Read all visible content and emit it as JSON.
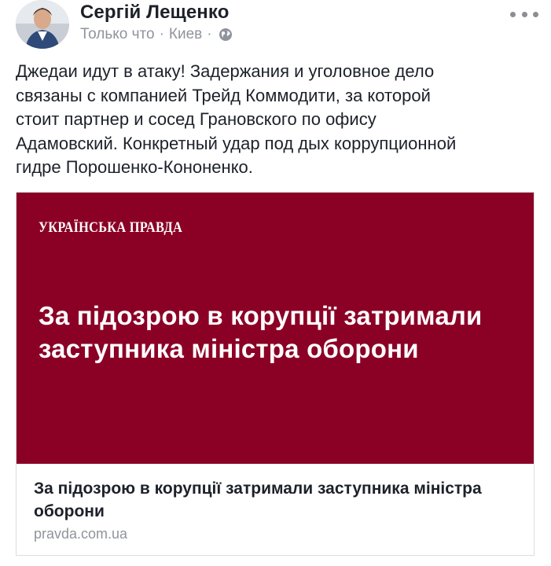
{
  "post": {
    "author": "Сергій Лещенко",
    "time": "Только что",
    "separator": "·",
    "location": "Киев",
    "privacy_icon": "globe-icon",
    "more_icon": "more-dots-icon",
    "text": "Джедаи идут в атаку! Задержания и уголовное дело\nсвязаны с компанией Трейд Коммодити, за которой\nстоит партнер и сосед Грановского по офису\nАдамовский. Конкретный удар под дых коррупционной\nгидре Порошенко-Кононенко."
  },
  "link_card": {
    "brand": "УКРАЇНСЬКА ПРАВДА",
    "image_headline": "За підозрою в корупції затримали заступника міністра оборони",
    "title": "За підозрою в корупції затримали заступника міністра оборони",
    "domain": "pravda.com.ua",
    "image_bg": "#8b0025"
  }
}
